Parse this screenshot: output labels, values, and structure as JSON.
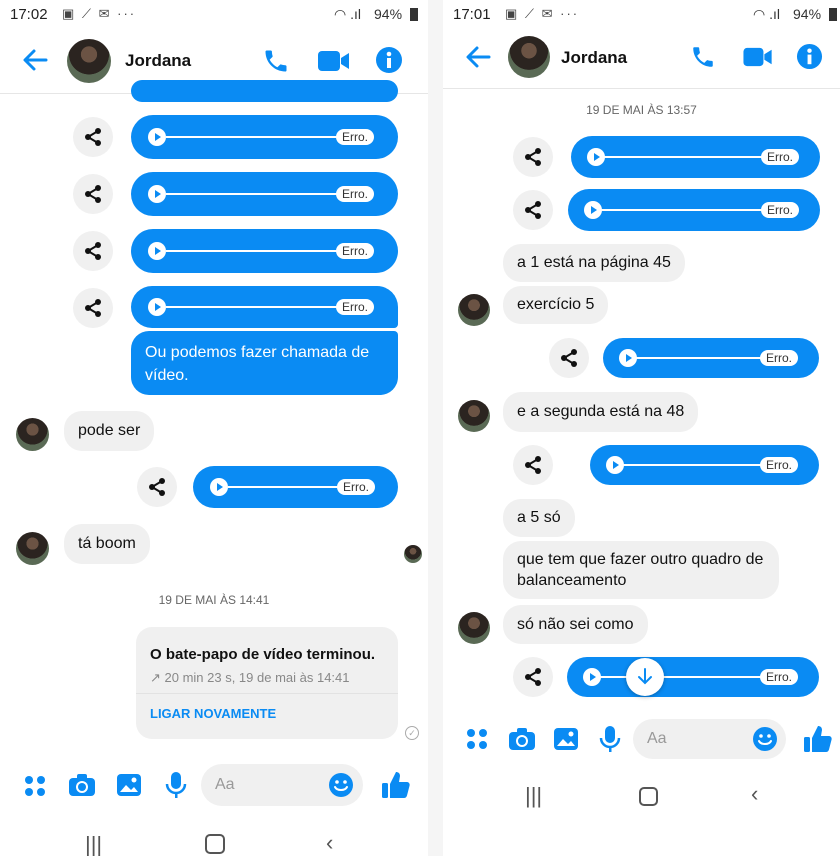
{
  "left": {
    "status": {
      "time": "17:02",
      "battery": "94%"
    },
    "header": {
      "name": "Jordana"
    },
    "audio_error": "Erro.",
    "message_out": "Ou podemos fazer chamada de vídeo.",
    "message_in_1": "pode ser",
    "message_in_2": "tá boom",
    "date": "19 DE MAI ÀS 14:41",
    "call_card": {
      "title": "O bate-papo de vídeo terminou.",
      "meta": "↗ 20 min 23 s, 19 de mai às 14:41",
      "action": "LIGAR NOVAMENTE"
    },
    "input_placeholder": "Aa"
  },
  "right": {
    "status": {
      "time": "17:01",
      "battery": "94%"
    },
    "header": {
      "name": "Jordana"
    },
    "date": "19 DE MAI ÀS 13:57",
    "audio_error": "Erro.",
    "messages": [
      "a 1 está na página 45",
      "exercício 5",
      "e a segunda está na 48",
      "a 5 só",
      "que tem que fazer outro quadro de balanceamento",
      "só não sei como"
    ],
    "input_placeholder": "Aa"
  },
  "colors": {
    "accent": "#0a8bf3",
    "bubble_in": "#f0f0f0"
  },
  "icons": [
    "back-arrow-icon",
    "phone-icon",
    "video-icon",
    "info-icon",
    "share-icon",
    "play-icon",
    "apps-icon",
    "camera-icon",
    "gallery-icon",
    "mic-icon",
    "emoji-icon",
    "like-icon",
    "recents-nav-icon",
    "home-nav-icon",
    "back-nav-icon",
    "scroll-down-icon"
  ]
}
